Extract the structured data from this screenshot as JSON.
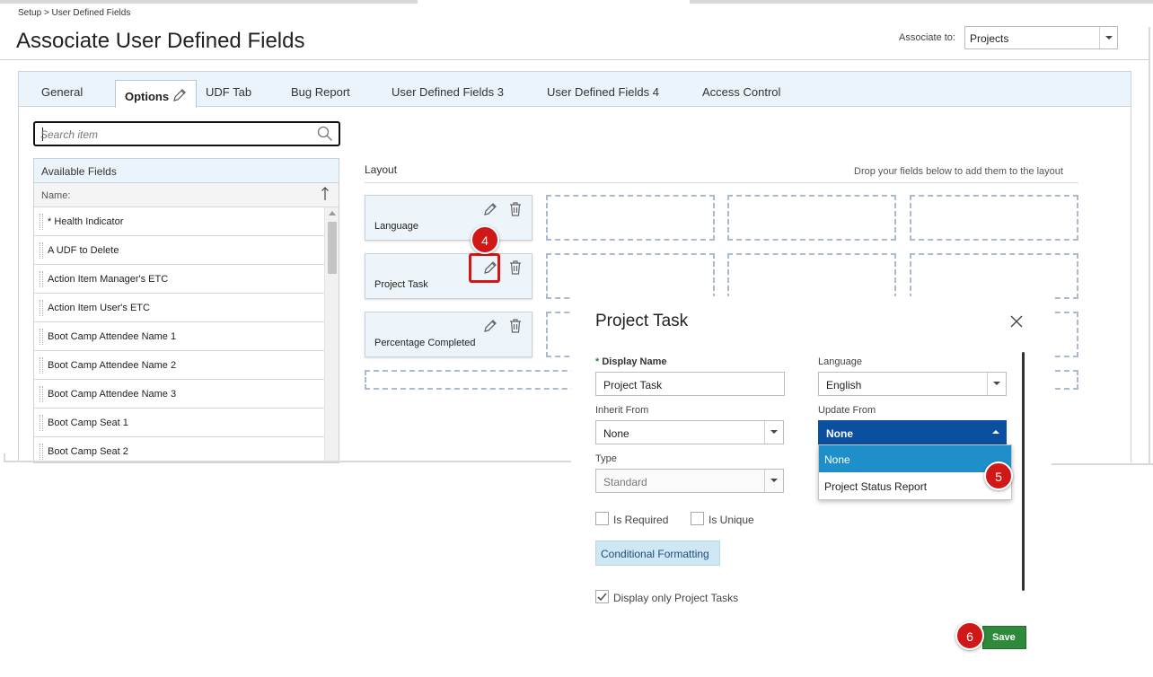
{
  "header": {
    "breadcrumb": "Setup > User Defined Fields",
    "title": "Associate User Defined Fields",
    "associate_label": "Associate to:",
    "associate_value": "Projects"
  },
  "tabs": [
    {
      "label": "General"
    },
    {
      "label": "Options",
      "active": true
    },
    {
      "label": "UDF Tab"
    },
    {
      "label": "Bug Report"
    },
    {
      "label": "User Defined Fields 3"
    },
    {
      "label": "User Defined Fields 4"
    },
    {
      "label": "Access Control"
    }
  ],
  "search": {
    "placeholder": "Search item"
  },
  "available_fields": {
    "title": "Available Fields",
    "column": "Name:",
    "items": [
      "* Health Indicator",
      "A UDF to Delete",
      "Action Item Manager's ETC",
      "Action Item User's ETC",
      "Boot Camp Attendee Name 1",
      "Boot Camp Attendee Name 2",
      "Boot Camp Attendee Name 3",
      "Boot Camp Seat 1",
      "Boot Camp Seat 2"
    ]
  },
  "layout": {
    "title": "Layout",
    "hint": "Drop your fields below to add them to the layout",
    "cards": [
      "Language",
      "Project Task",
      "Percentage Completed"
    ]
  },
  "modal": {
    "title": "Project Task",
    "display_name_label": "Display Name",
    "display_name_value": "Project Task",
    "language_label": "Language",
    "language_value": "English",
    "inherit_from_label": "Inherit From",
    "inherit_from_value": "None",
    "update_from_label": "Update From",
    "update_from_value": "None",
    "update_from_options": [
      "None",
      "Project Status Report"
    ],
    "type_label": "Type",
    "type_value": "Standard",
    "is_required_label": "Is Required",
    "is_unique_label": "Is Unique",
    "conditional_formatting_label": "Conditional Formatting",
    "display_only_project_tasks_label": "Display only Project Tasks",
    "display_only_project_tasks_checked": true,
    "save_label": "Save"
  },
  "badges": {
    "step4": "4",
    "step5": "5",
    "step6": "6"
  },
  "colors": {
    "accent_blue": "#0a4fa0",
    "dropdown_selected": "#1e8fc9",
    "save_green": "#2e8a3b",
    "badge_red": "#d01818",
    "tab_bar": "#eaf4fa"
  }
}
